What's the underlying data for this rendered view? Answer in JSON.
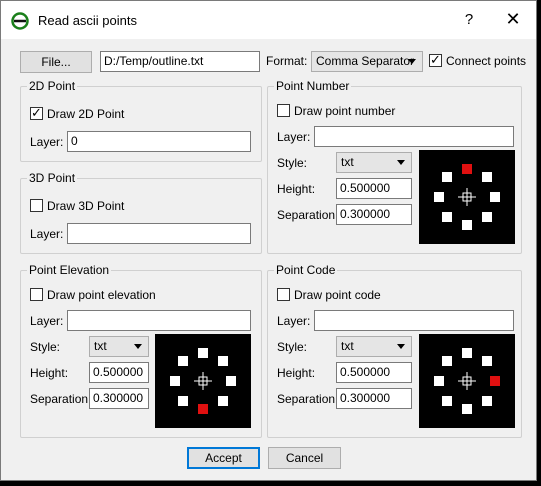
{
  "window": {
    "title": "Read ascii points",
    "help_label": "?",
    "close_label": "✕"
  },
  "file_row": {
    "file_button": "File...",
    "path": "D:/Temp/outline.txt",
    "format_label": "Format:",
    "format_value": "Comma Separator",
    "connect_points_label": "Connect points",
    "connect_points_checked": true
  },
  "point_2d": {
    "title": "2D Point",
    "draw_label": "Draw 2D Point",
    "draw_checked": true,
    "layer_label": "Layer:",
    "layer_value": "0"
  },
  "point_3d": {
    "title": "3D Point",
    "draw_label": "Draw 3D Point",
    "draw_checked": false,
    "layer_label": "Layer:",
    "layer_value": ""
  },
  "point_number": {
    "title": "Point Number",
    "draw_label": "Draw point number",
    "draw_checked": false,
    "layer_label": "Layer:",
    "layer_value": "",
    "style_label": "Style:",
    "style_value": "txt",
    "height_label": "Height:",
    "height_value": "0.500000",
    "separation_label": "Separation",
    "separation_value": "0.300000",
    "highlight_position": "top"
  },
  "point_elevation": {
    "title": "Point Elevation",
    "draw_label": "Draw point elevation",
    "draw_checked": false,
    "layer_label": "Layer:",
    "layer_value": "",
    "style_label": "Style:",
    "style_value": "txt",
    "height_label": "Height:",
    "height_value": "0.500000",
    "separation_label": "Separation",
    "separation_value": "0.300000",
    "highlight_position": "bottom"
  },
  "point_code": {
    "title": "Point Code",
    "draw_label": "Draw point code",
    "draw_checked": false,
    "layer_label": "Layer:",
    "layer_value": "",
    "style_label": "Style:",
    "style_value": "txt",
    "height_label": "Height:",
    "height_value": "0.500000",
    "separation_label": "Separation",
    "separation_value": "0.300000",
    "highlight_position": "right"
  },
  "footer": {
    "accept_label": "Accept",
    "cancel_label": "Cancel"
  },
  "colors": {
    "highlight": "#e01010",
    "marker": "#ffffff",
    "preview_bg": "#000000"
  }
}
